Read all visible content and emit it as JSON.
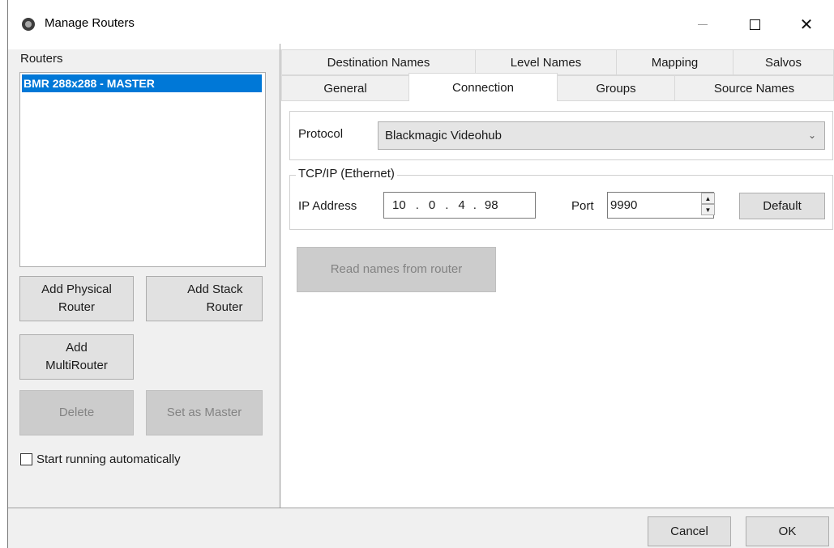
{
  "window": {
    "title": "Manage Routers",
    "controls": {
      "minimize": "—",
      "maximize": "□",
      "close": "✕"
    }
  },
  "left": {
    "routers_label": "Routers",
    "routers": [
      "BMR 288x288 - MASTER"
    ],
    "buttons": {
      "add_physical": "Add Physical Router",
      "add_stack": "Add Stack Router",
      "add_multi": "Add MultiRouter",
      "delete": "Delete",
      "set_master": "Set as Master"
    },
    "start_auto_label": "Start running automatically",
    "start_auto_checked": false
  },
  "tabs": {
    "row1": [
      "Destination Names",
      "Level Names",
      "Mapping",
      "Salvos"
    ],
    "row2": [
      "General",
      "Connection",
      "Groups",
      "Source Names"
    ],
    "active": "Connection"
  },
  "connection": {
    "protocol_label": "Protocol",
    "protocol_value": "Blackmagic Videohub",
    "group_title": "TCP/IP (Ethernet)",
    "ip_label": "IP Address",
    "ip_value": [
      "10",
      "0",
      "4",
      "98"
    ],
    "port_label": "Port",
    "port_value": "9990",
    "default_button": "Default",
    "read_names_button": "Read names from router"
  },
  "footer": {
    "cancel": "Cancel",
    "ok": "OK"
  }
}
